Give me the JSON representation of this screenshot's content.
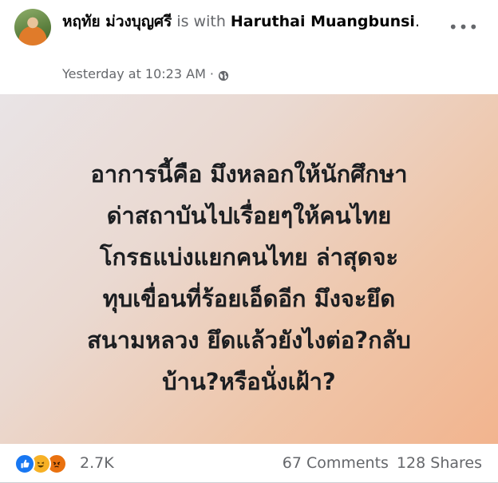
{
  "header": {
    "author_name": "หฤทัย ม่วงบุญศรี",
    "with_text": " is with ",
    "tagged_name": "Haruthai Muangbunsi",
    "period": ".",
    "timestamp": "Yesterday at 10:23 AM",
    "separator": "·",
    "privacy_icon": "globe-icon",
    "more_label": "•••"
  },
  "post": {
    "lines": [
      "อาการนี้คือ มึงหลอกให้นักศึกษา",
      "ด่าสถาบันไปเรื่อยๆให้คนไทย",
      "โกรธแบ่งแยกคนไทย ล่าสุดจะ",
      "ทุบเขื่อนที่ร้อยเอ็ดอีก มึงจะยึด",
      "สนามหลวง ยึดแล้วยังไงต่อ?กลับ",
      "บ้าน?หรือนั่งเฝ้า?"
    ]
  },
  "footer": {
    "reaction_icons": [
      "like-icon",
      "haha-icon",
      "angry-icon"
    ],
    "reaction_count": "2.7K",
    "comments": "67 Comments",
    "shares": "128 Shares"
  },
  "colors": {
    "secondary_text": "#65676b",
    "like_blue": "#1877f2",
    "haha_yellow": "#f7b125",
    "angry_orange": "#e9710f"
  }
}
